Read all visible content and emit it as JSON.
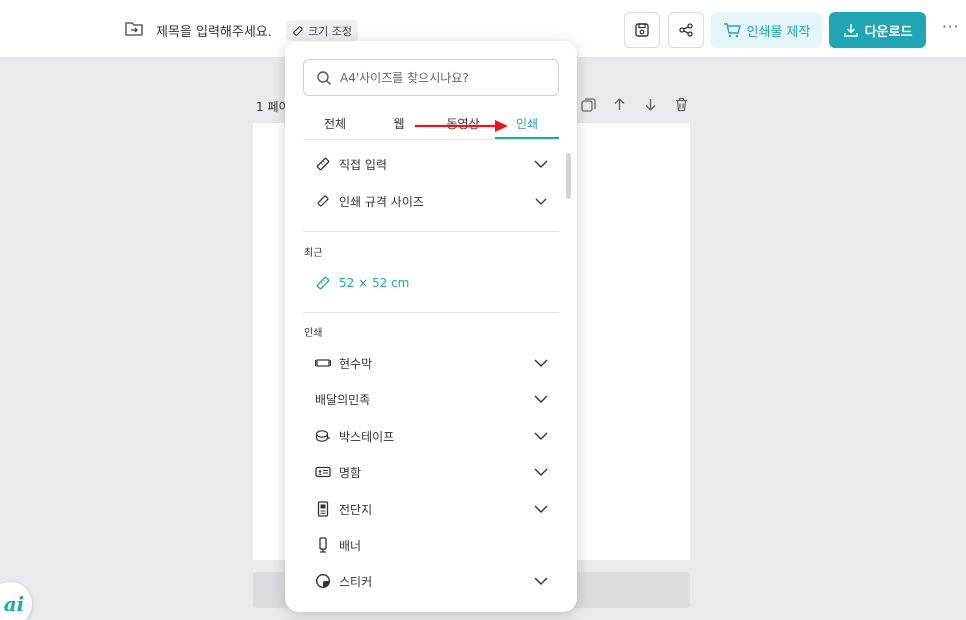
{
  "topbar": {
    "doc_title": "제목을 입력해주세요.",
    "resize_label": "크기 조정",
    "print_label": "인쇄물 제작",
    "download_label": "다운로드",
    "more_label": "···"
  },
  "editor": {
    "page_label": "1 페이",
    "ai_label": "ai"
  },
  "dropdown": {
    "search_placeholder": "A4'사이즈를 찾으시나요?",
    "tabs": [
      {
        "label": "전체"
      },
      {
        "label": "웹"
      },
      {
        "label": "동영상"
      },
      {
        "label": "인쇄"
      }
    ],
    "active_tab": "인쇄",
    "custom_rows": [
      {
        "label": "직접 입력",
        "icon": "ruler-icon"
      },
      {
        "label": "인쇄 규격 사이즈",
        "icon": "ruler-icon"
      }
    ],
    "recent_label": "최근",
    "recent_items": [
      {
        "label": "52 × 52 cm",
        "icon": "ruler-icon"
      }
    ],
    "print_label": "인쇄",
    "print_rows": [
      {
        "label": "현수막",
        "icon": "banner-hanging-icon",
        "expandable": true
      },
      {
        "label": "배달의민족",
        "icon": "",
        "expandable": true
      },
      {
        "label": "박스테이프",
        "icon": "tape-icon",
        "expandable": true
      },
      {
        "label": "명함",
        "icon": "business-card-icon",
        "expandable": true
      },
      {
        "label": "전단지",
        "icon": "flyer-icon",
        "expandable": true
      },
      {
        "label": "배너",
        "icon": "standing-banner-icon",
        "expandable": false
      },
      {
        "label": "스티커",
        "icon": "sticker-icon",
        "expandable": true
      }
    ]
  },
  "colors": {
    "accent": "#1fa5b4",
    "accent_light": "#e5f6f8",
    "annotation_arrow": "#e8161b"
  }
}
